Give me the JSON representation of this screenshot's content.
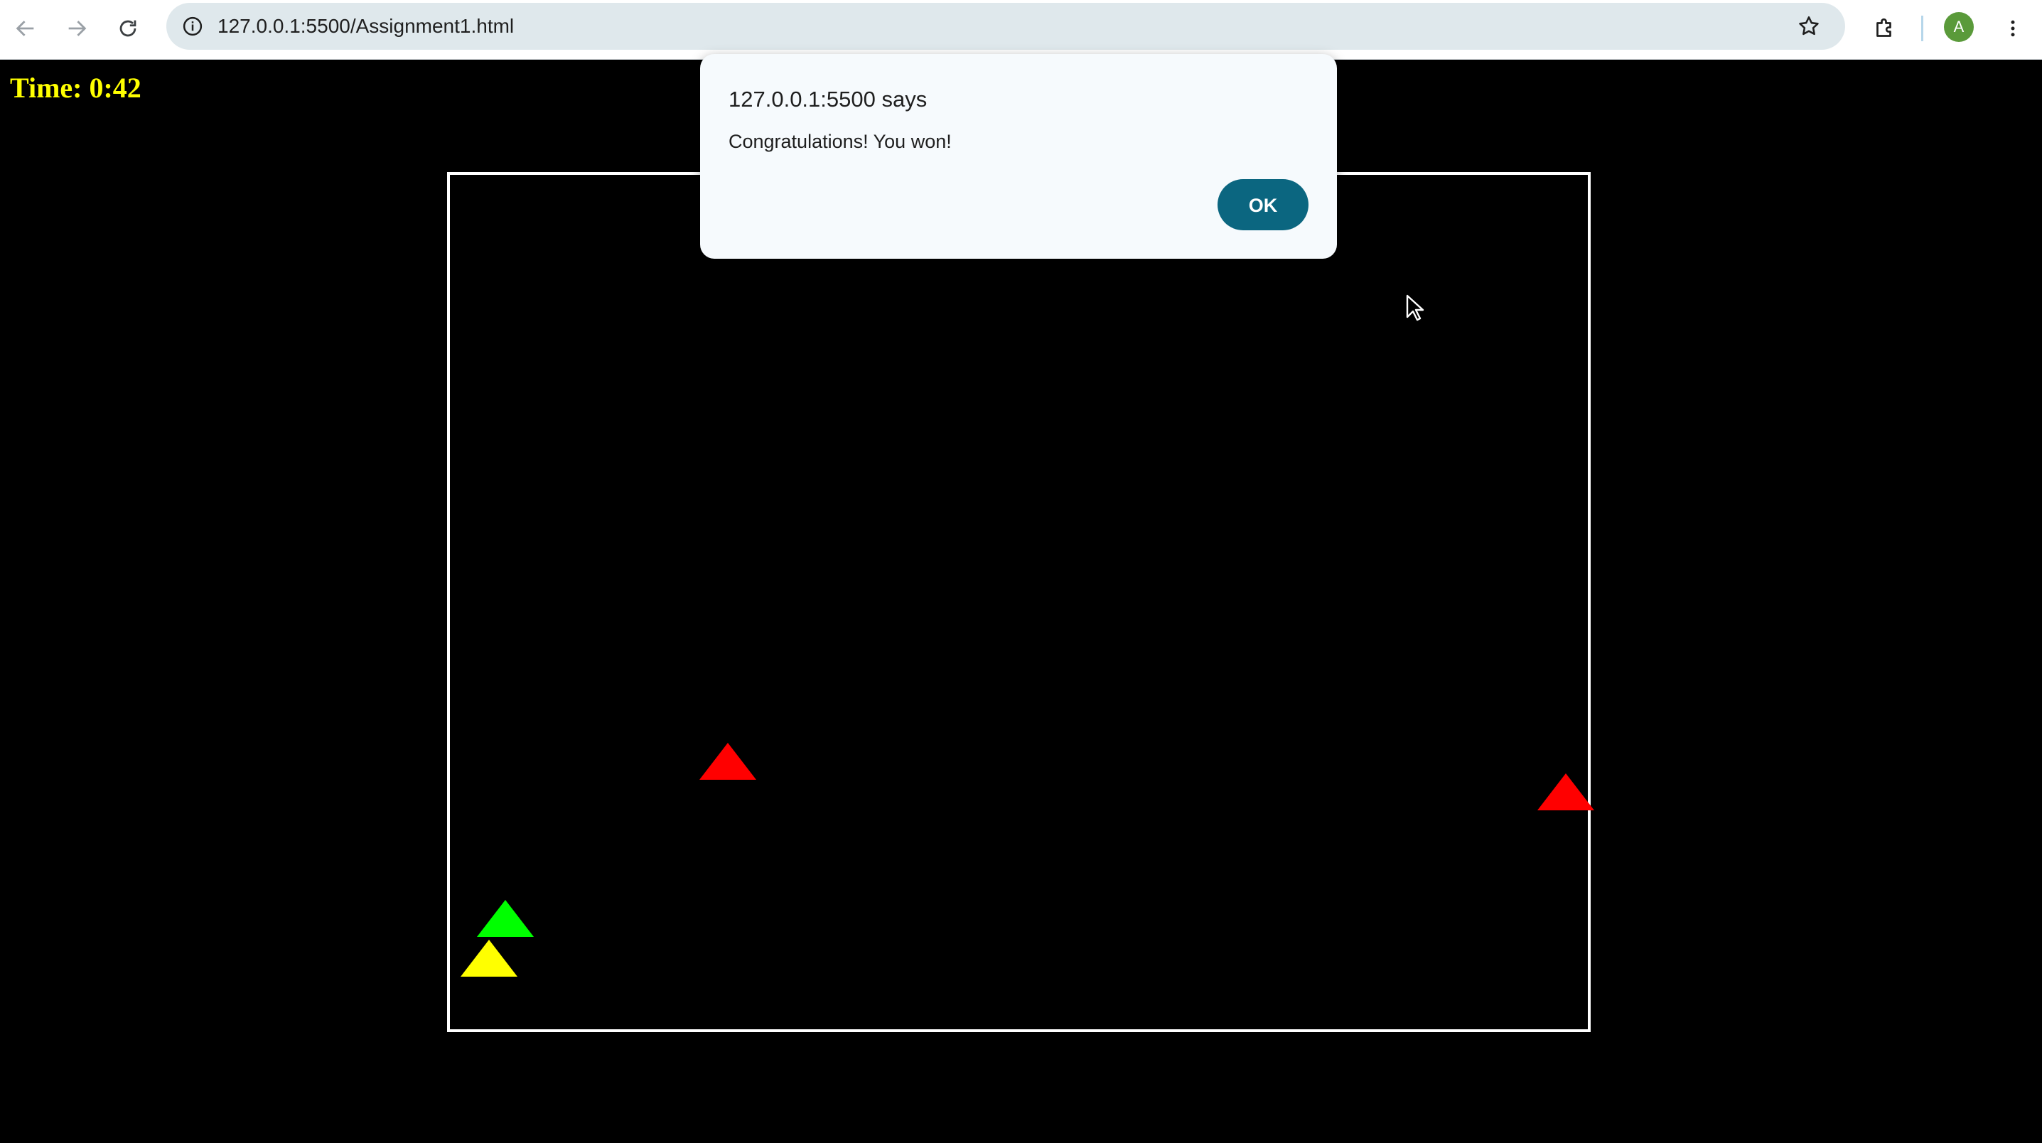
{
  "browser": {
    "url": "127.0.0.1:5500/Assignment1.html",
    "profile_initial": "A",
    "icons": {
      "back": "arrow-left-icon",
      "forward": "arrow-right-icon",
      "reload": "reload-icon",
      "site_info": "info-icon",
      "bookmark": "star-icon",
      "extensions": "puzzle-icon",
      "menu": "kebab-menu-icon"
    }
  },
  "game": {
    "timer": "Time: 0:42",
    "colors": {
      "background": "#000000",
      "border": "#ffffff",
      "timer": "#ffff00",
      "enemy": "#ff0000",
      "goal": "#00ff00",
      "player": "#ffff00"
    },
    "pieces": [
      {
        "role": "enemy",
        "color": "red"
      },
      {
        "role": "enemy",
        "color": "red"
      },
      {
        "role": "goal",
        "color": "green"
      },
      {
        "role": "player",
        "color": "yellow"
      }
    ]
  },
  "alert": {
    "title": "127.0.0.1:5500 says",
    "message": "Congratulations! You won!",
    "ok_label": "OK",
    "button_color": "#0b6680"
  }
}
